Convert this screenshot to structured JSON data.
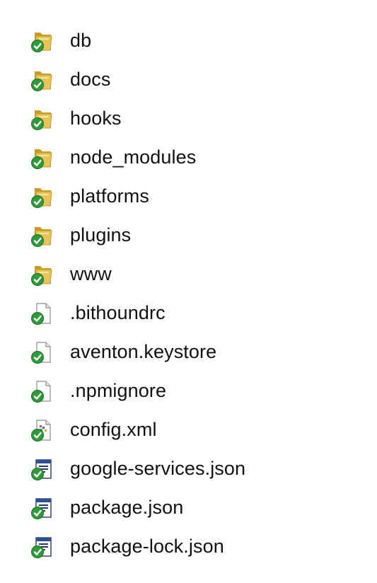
{
  "files": [
    {
      "name": "db",
      "icon": "folder-synced-icon"
    },
    {
      "name": "docs",
      "icon": "folder-synced-icon"
    },
    {
      "name": "hooks",
      "icon": "folder-synced-icon"
    },
    {
      "name": "node_modules",
      "icon": "folder-synced-icon"
    },
    {
      "name": "platforms",
      "icon": "folder-synced-icon"
    },
    {
      "name": "plugins",
      "icon": "folder-synced-icon"
    },
    {
      "name": "www",
      "icon": "folder-synced-icon"
    },
    {
      "name": ".bithoundrc",
      "icon": "file-synced-icon"
    },
    {
      "name": "aventon.keystore",
      "icon": "file-synced-icon"
    },
    {
      "name": ".npmignore",
      "icon": "file-synced-icon"
    },
    {
      "name": "config.xml",
      "icon": "xml-file-synced-icon"
    },
    {
      "name": "google-services.json",
      "icon": "json-file-synced-icon"
    },
    {
      "name": "package.json",
      "icon": "json-file-synced-icon"
    },
    {
      "name": "package-lock.json",
      "icon": "json-file-synced-icon"
    }
  ],
  "colors": {
    "folder": "#e7c457",
    "folder_dark": "#c99b2a",
    "sync_badge": "#2e9b3a",
    "text": "#111111"
  }
}
